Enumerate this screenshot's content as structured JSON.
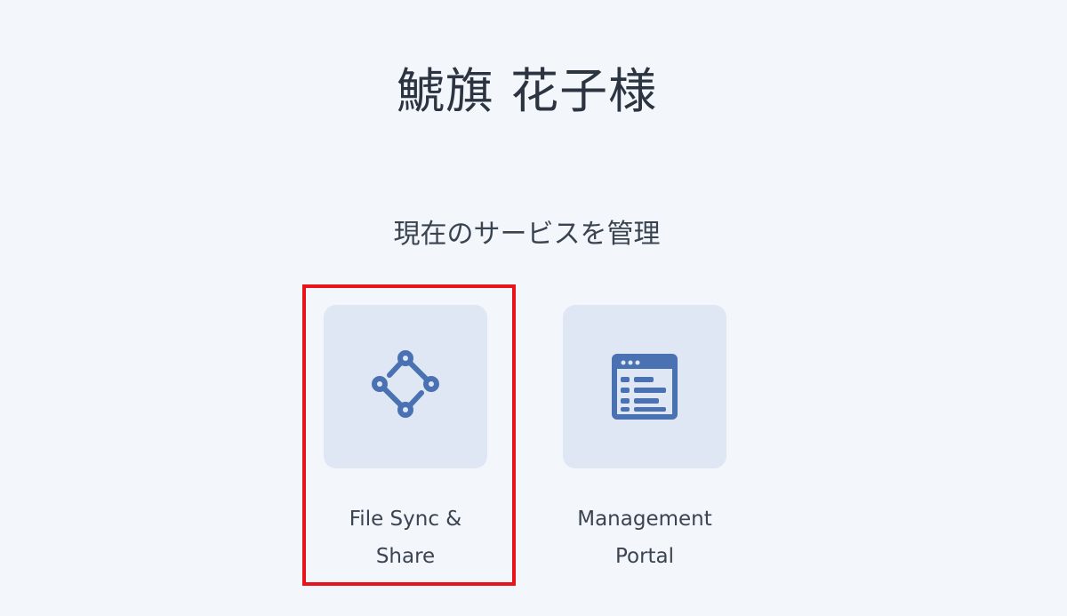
{
  "header": {
    "user_name": "鯱旗 花子様"
  },
  "services_section": {
    "title": "現在のサービスを管理",
    "items": [
      {
        "label": "File Sync &\nShare",
        "icon": "sync-share-icon"
      },
      {
        "label": "Management\nPortal",
        "icon": "portal-icon"
      }
    ]
  },
  "colors": {
    "background": "#f3f6fb",
    "tile": "#dfe7f4",
    "icon": "#4a72b3",
    "highlight": "#e8141a"
  }
}
